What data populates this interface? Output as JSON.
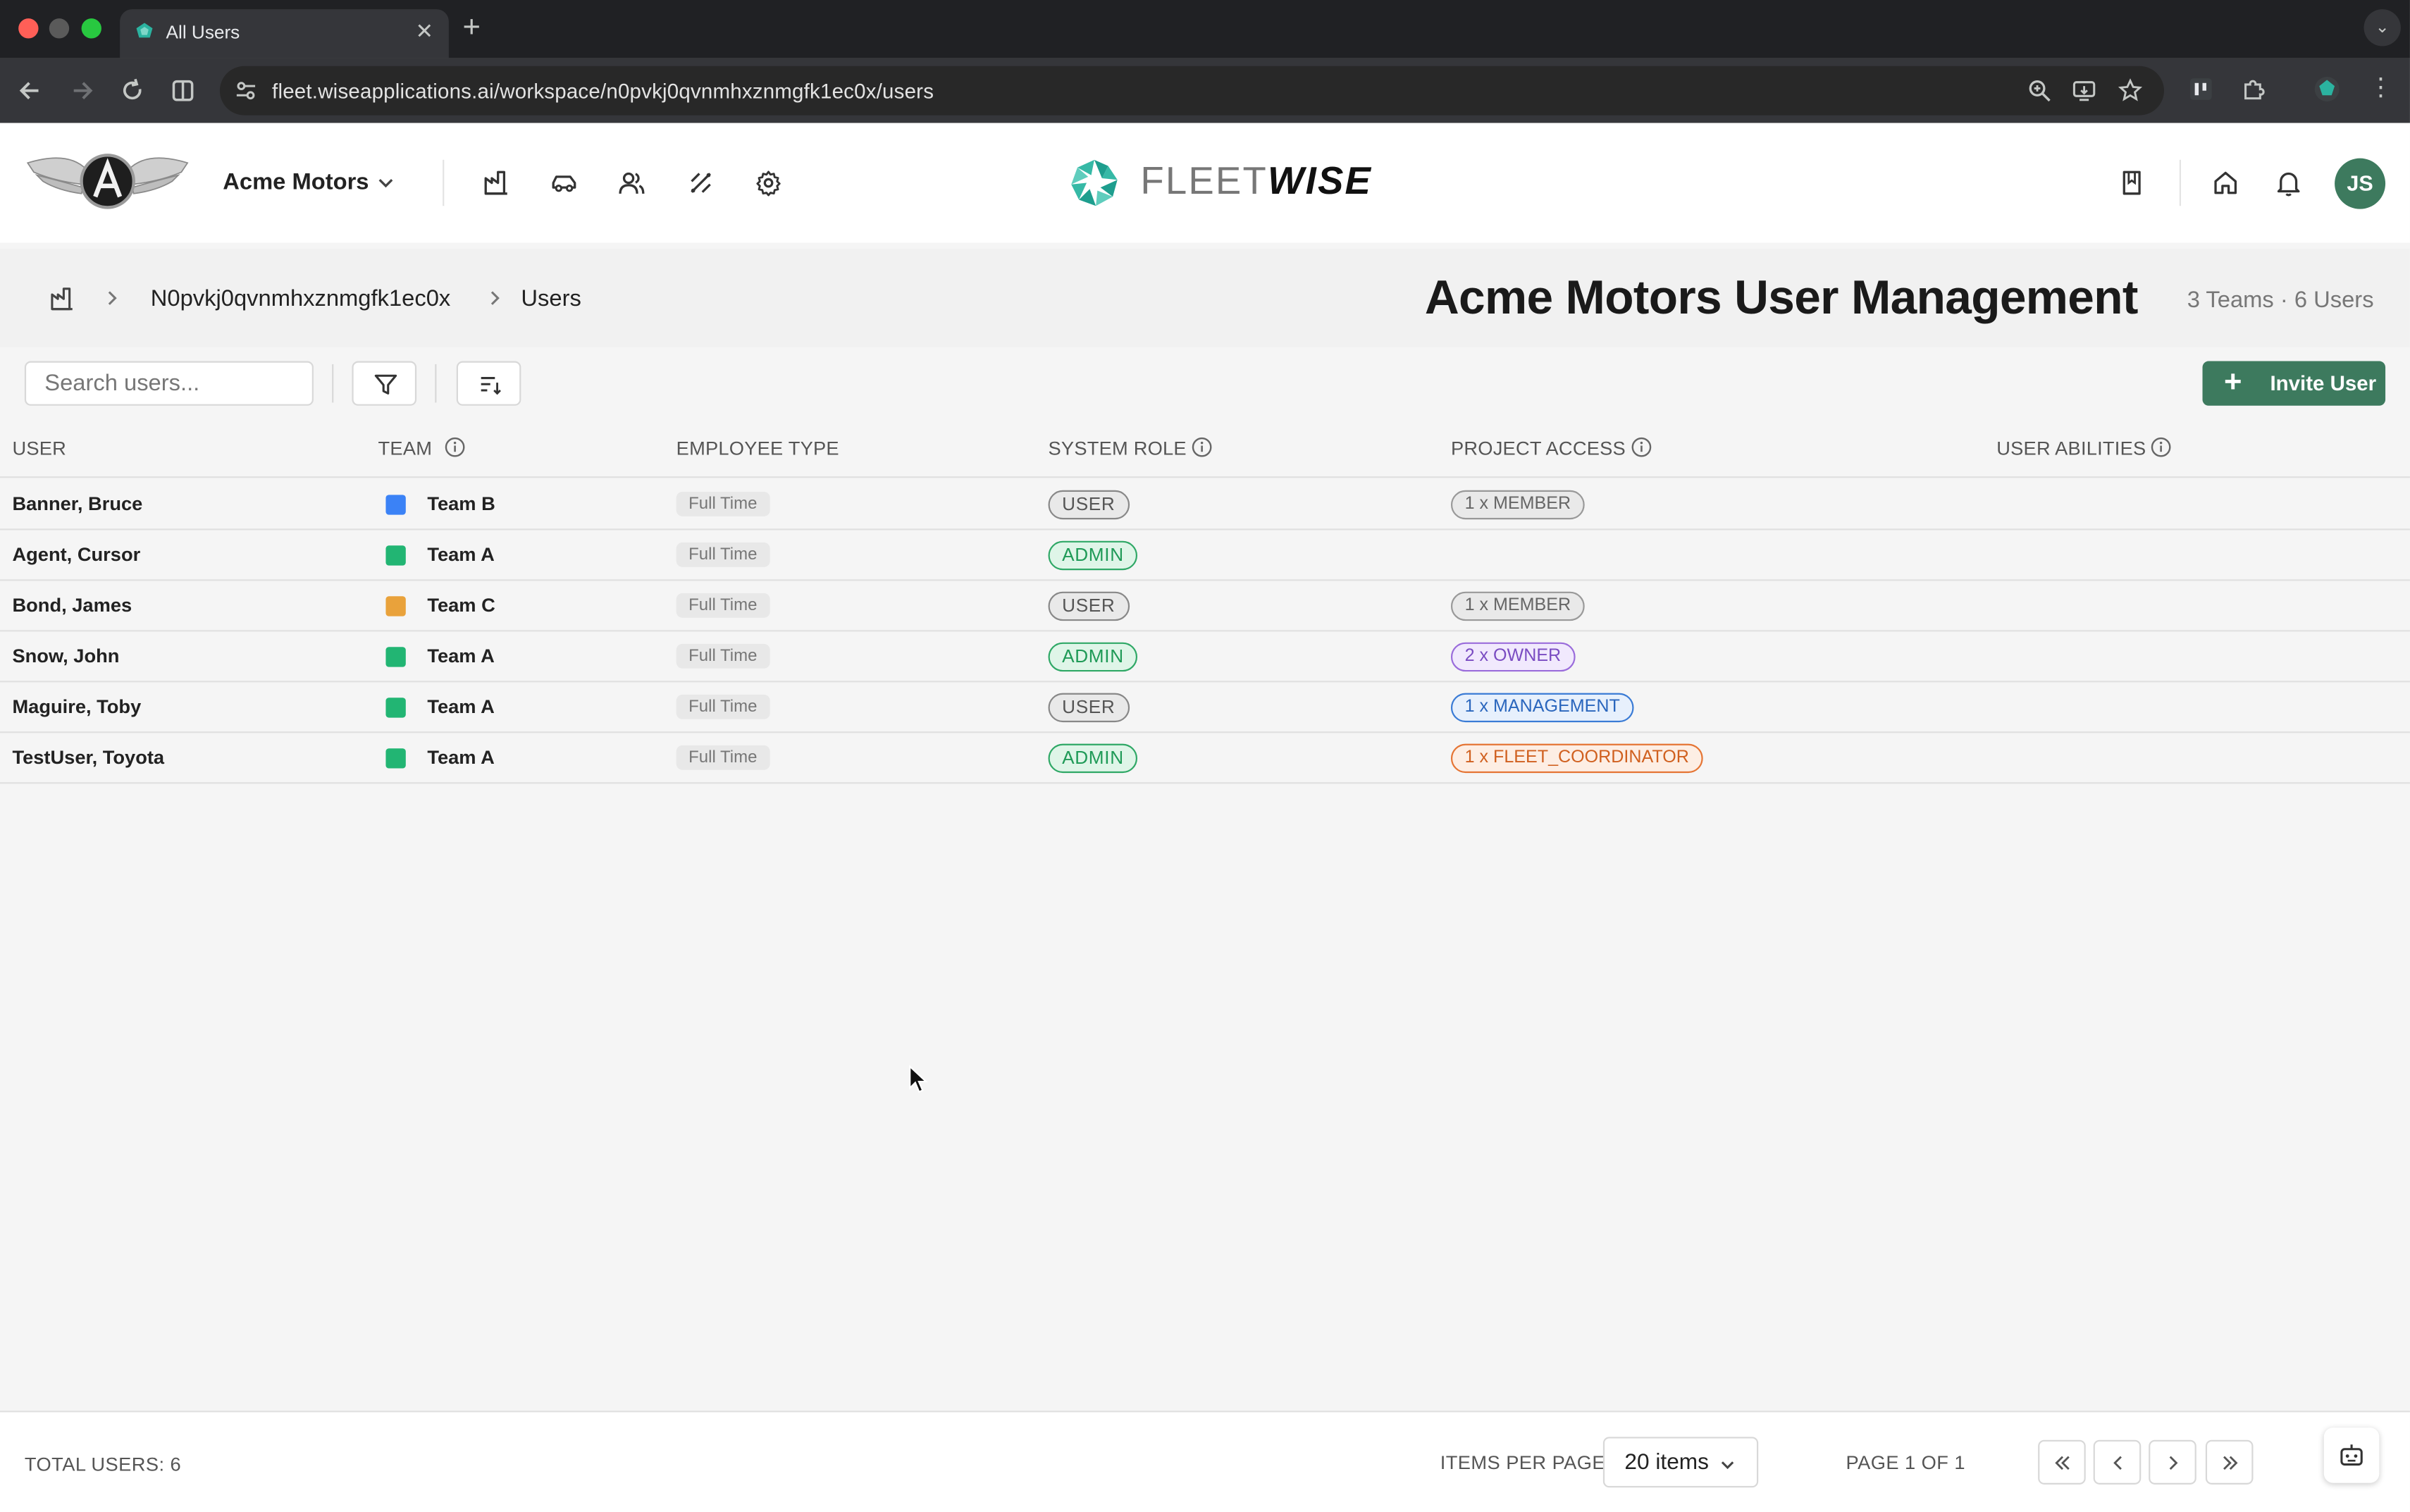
{
  "browser": {
    "tab_title": "All Users",
    "url": "fleet.wiseapplications.ai/workspace/n0pvkj0qvnmhxznmgfk1ec0x/users"
  },
  "header": {
    "org_name": "Acme Motors",
    "brand_light": "FLEET",
    "brand_bold": "WISE",
    "avatar_initials": "JS",
    "accent_color": "#3d7a5e"
  },
  "breadcrumb": {
    "workspace": "N0pvkj0qvnmhxznmgfk1ec0x",
    "current": "Users"
  },
  "page": {
    "title": "Acme Motors User Management",
    "meta": "3 Teams · 6 Users"
  },
  "controls": {
    "search_placeholder": "Search users...",
    "invite_label": "Invite User"
  },
  "table": {
    "columns": {
      "user": "USER",
      "team": "TEAM",
      "employee_type": "EMPLOYEE TYPE",
      "system_role": "SYSTEM ROLE",
      "project_access": "PROJECT ACCESS",
      "user_abilities": "USER ABILITIES"
    },
    "rows": [
      {
        "user": "Banner, Bruce",
        "team": "Team B",
        "team_color": "#3b82f6",
        "employee_type": "Full Time",
        "system_role": "USER",
        "project_access": "1 x MEMBER"
      },
      {
        "user": "Agent, Cursor",
        "team": "Team A",
        "team_color": "#22b573",
        "employee_type": "Full Time",
        "system_role": "ADMIN",
        "project_access": ""
      },
      {
        "user": "Bond, James",
        "team": "Team C",
        "team_color": "#e9a23b",
        "employee_type": "Full Time",
        "system_role": "USER",
        "project_access": "1 x MEMBER"
      },
      {
        "user": "Snow, John",
        "team": "Team A",
        "team_color": "#22b573",
        "employee_type": "Full Time",
        "system_role": "ADMIN",
        "project_access": "2 x OWNER"
      },
      {
        "user": "Maguire, Toby",
        "team": "Team A",
        "team_color": "#22b573",
        "employee_type": "Full Time",
        "system_role": "USER",
        "project_access": "1 x MANAGEMENT"
      },
      {
        "user": "TestUser, Toyota",
        "team": "Team A",
        "team_color": "#22b573",
        "employee_type": "Full Time",
        "system_role": "ADMIN",
        "project_access": "1 x FLEET_COORDINATOR"
      }
    ]
  },
  "footer": {
    "total": "TOTAL USERS: 6",
    "items_per_page_label": "ITEMS PER PAGE",
    "items_per_page_value": "20 items",
    "page_indicator": "PAGE 1 OF 1"
  }
}
